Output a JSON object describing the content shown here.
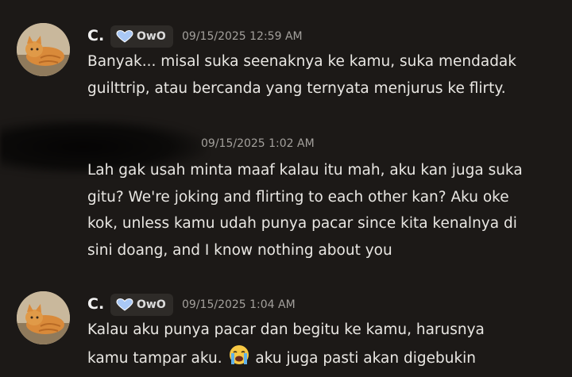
{
  "messages": [
    {
      "author": "C.",
      "tag_label": "OwO",
      "tag_icon": "heart-icon",
      "timestamp": "09/15/2025 12:59 AM",
      "lines": [
        "Banyak... misal suka seenaknya ke kamu, suka mendadak",
        "guilttrip, atau bercanda yang ternyata menjurus ke flirty."
      ]
    },
    {
      "author": "",
      "timestamp": "09/15/2025 1:02 AM",
      "lines": [
        "Lah gak usah minta maaf kalau itu mah, aku kan juga suka",
        "gitu? We're joking and flirting to each other kan? Aku oke",
        "kok, unless kamu udah punya pacar since kita kenalnya di",
        "sini doang, and I know nothing about you"
      ]
    },
    {
      "author": "C.",
      "tag_label": "OwO",
      "tag_icon": "heart-icon",
      "timestamp": "09/15/2025 1:04 AM",
      "lines": [
        "Kalau aku punya pacar dan begitu ke kamu, harusnya",
        "kamu tampar aku.",
        "aku juga pasti akan digebukin"
      ],
      "emoji": "loudly-crying-face-emoji"
    }
  ],
  "colors": {
    "background": "#1c1917",
    "tag_background": "#2e2b28",
    "heart": "#a9c8f5",
    "timestamp": "#a3a09c"
  }
}
